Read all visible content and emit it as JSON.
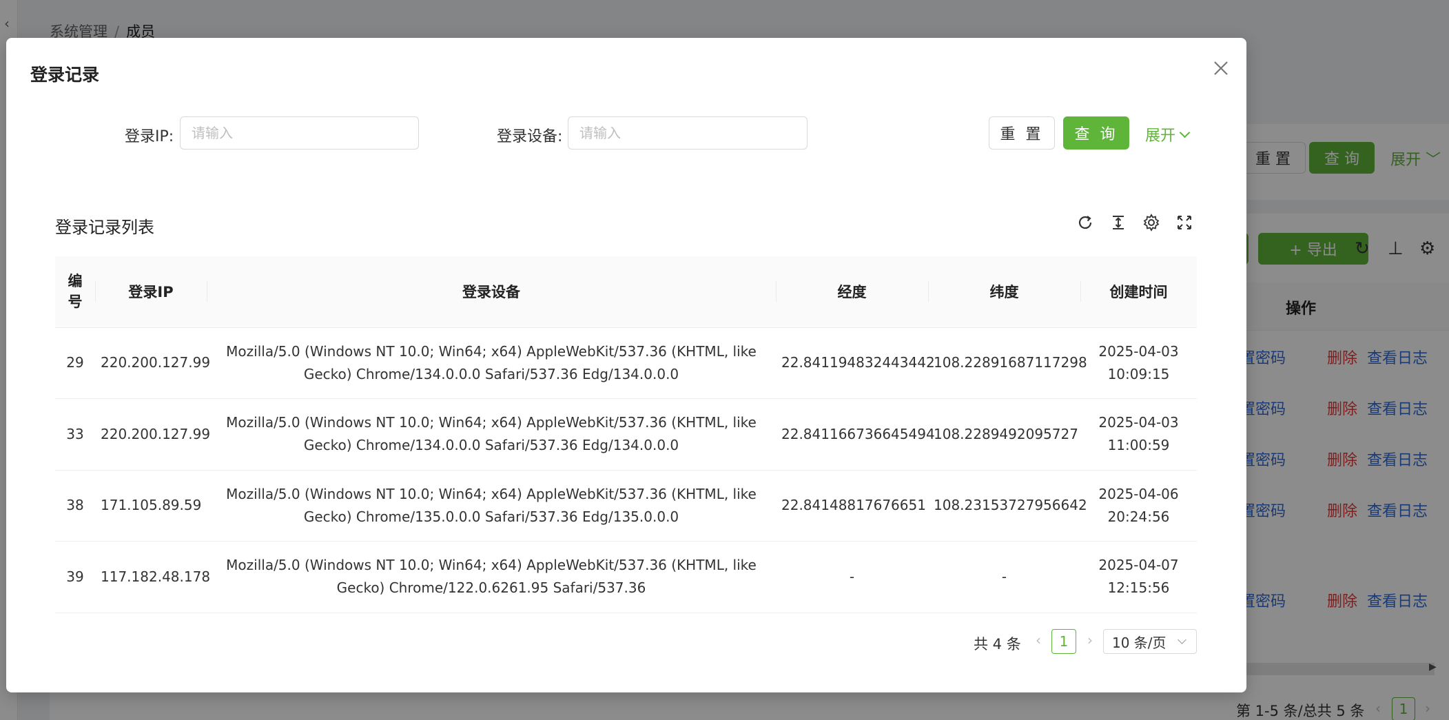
{
  "background": {
    "breadcrumb": [
      "系统管理",
      "成员"
    ],
    "breadcrumb_sep": "/",
    "reset_label": "重 置",
    "query_label": "查 询",
    "expand_label": "展开",
    "export_label": "+ 导出",
    "operations_header": "操作",
    "row_actions": {
      "reset_pwd": "置密码",
      "delete": "删除",
      "view_log": "查看日志"
    },
    "pagination_text": "第 1-5 条/总共 5 条",
    "page": "1"
  },
  "modal": {
    "title": "登录记录",
    "search": {
      "ip_label": "登录IP:",
      "ip_placeholder": "请输入",
      "device_label": "登录设备:",
      "device_placeholder": "请输入",
      "reset_label": "重 置",
      "query_label": "查 询",
      "expand_label": "展开"
    },
    "list_title": "登录记录列表",
    "table": {
      "headers": [
        "编号",
        "登录IP",
        "登录设备",
        "经度",
        "纬度",
        "创建时间"
      ],
      "rows": [
        {
          "id": "29",
          "ip": "220.200.127.99",
          "device": "Mozilla/5.0 (Windows NT 10.0; Win64; x64) AppleWebKit/537.36 (KHTML, like Gecko) Chrome/134.0.0.0 Safari/537.36 Edg/134.0.0.0",
          "lng": "22.841194832443442",
          "lat": "108.22891687117298",
          "date": "2025-04-03",
          "time": "10:09:15"
        },
        {
          "id": "33",
          "ip": "220.200.127.99",
          "device": "Mozilla/5.0 (Windows NT 10.0; Win64; x64) AppleWebKit/537.36 (KHTML, like Gecko) Chrome/134.0.0.0 Safari/537.36 Edg/134.0.0.0",
          "lng": "22.841166736645494",
          "lat": "108.2289492095727",
          "date": "2025-04-03",
          "time": "11:00:59"
        },
        {
          "id": "38",
          "ip": "171.105.89.59",
          "device": "Mozilla/5.0 (Windows NT 10.0; Win64; x64) AppleWebKit/537.36 (KHTML, like Gecko) Chrome/135.0.0.0 Safari/537.36 Edg/135.0.0.0",
          "lng": "22.84148817676651",
          "lat": "108.23153727956642",
          "date": "2025-04-06",
          "time": "20:24:56"
        },
        {
          "id": "39",
          "ip": "117.182.48.178",
          "device": "Mozilla/5.0 (Windows NT 10.0; Win64; x64) AppleWebKit/537.36 (KHTML, like Gecko) Chrome/122.0.6261.95 Safari/537.36",
          "lng": "-",
          "lat": "-",
          "date": "2025-04-07",
          "time": "12:15:56"
        }
      ]
    },
    "pagination": {
      "total": "共 4 条",
      "current": "1",
      "page_size": "10 条/页"
    }
  },
  "colors": {
    "accent": "#5fb53a",
    "danger": "#e03a3a",
    "link": "#2f6bd8"
  }
}
